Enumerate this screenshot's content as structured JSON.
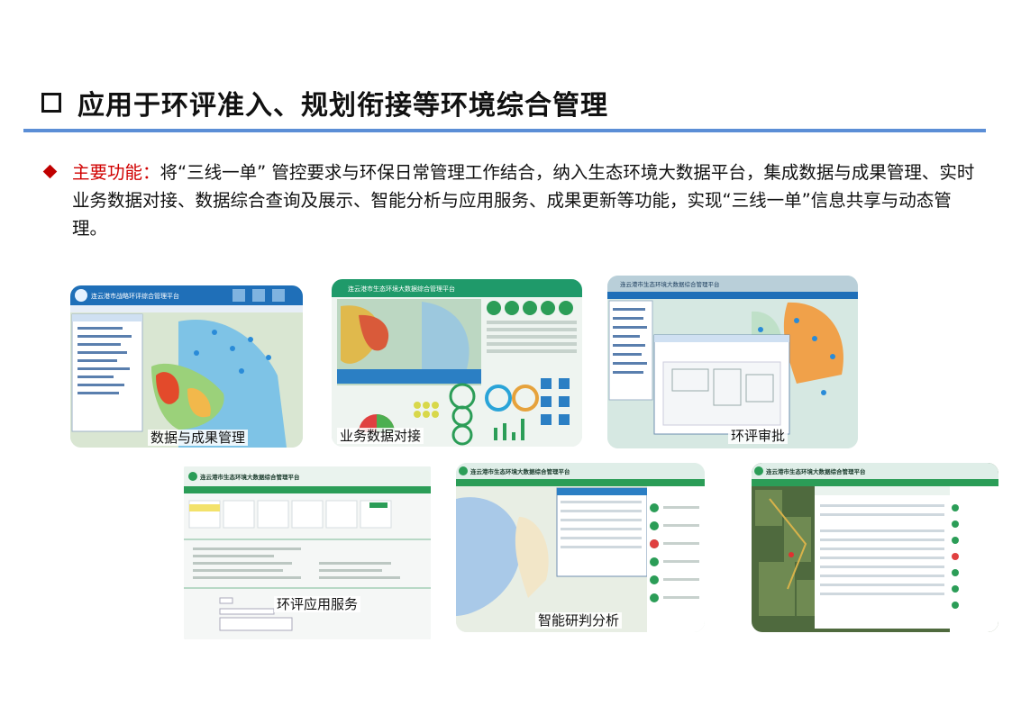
{
  "heading": {
    "title": "应用于环评准入、规划衔接等环境综合管理"
  },
  "description": {
    "label": "主要功能：",
    "text": "将“三线一单” 管控要求与环保日常管理工作结合，纳入生态环境大数据平台，集成数据与成果管理、实时业务数据对接、数据综合查询及展示、智能分析与应用服务、成果更新等功能，实现“三线一单”信息共享与动态管理。"
  },
  "screenshots": [
    {
      "caption": "数据与成果管理",
      "app_title": "连云港市战略环评综合管理平台"
    },
    {
      "caption": "业务数据对接",
      "app_title": "连云港市生态环境大数据综合管理平台"
    },
    {
      "caption": "环评审批",
      "app_title": "连云港市生态环境大数据综合管理平台"
    },
    {
      "caption": "环评应用服务",
      "app_title": "连云港市生态环境大数据综合管理平台"
    },
    {
      "caption": "智能研判分析",
      "app_title": "连云港市生态环境大数据综合管理平台"
    },
    {
      "caption": "",
      "app_title": "连云港市生态环境大数据综合管理平台"
    }
  ],
  "colors": {
    "accent_rule": "#5b8ed6",
    "key_red": "#d00000",
    "header_blue": "#1f6fb8",
    "header_green": "#1f9a6a"
  }
}
